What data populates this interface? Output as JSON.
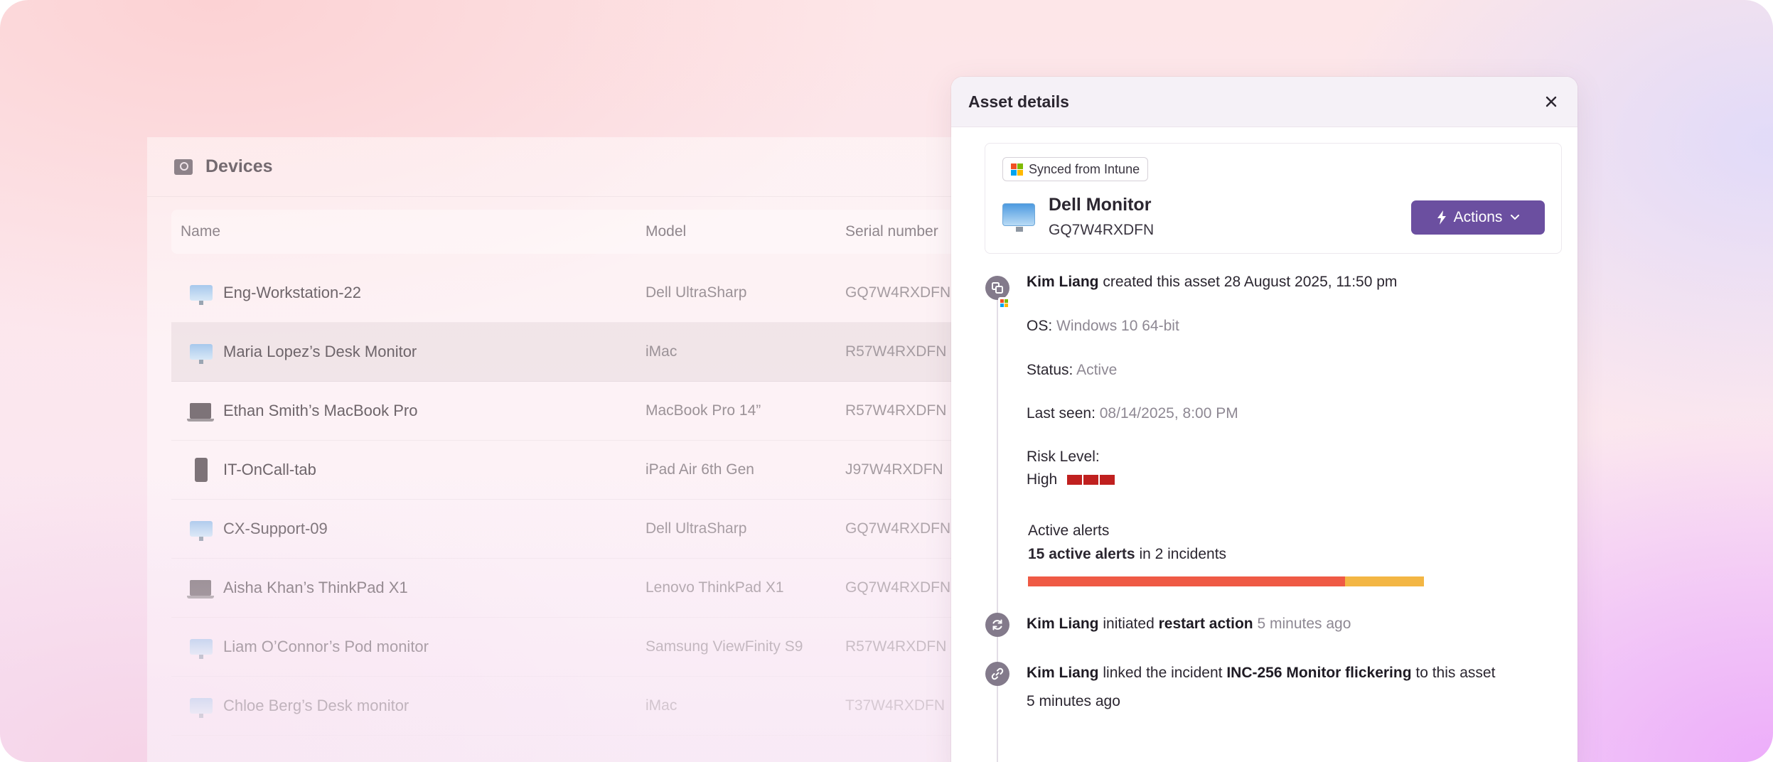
{
  "devices": {
    "title": "Devices",
    "columns": {
      "name": "Name",
      "model": "Model",
      "serial": "Serial number"
    },
    "rows": [
      {
        "name": "Eng-Workstation-22",
        "model": "Dell UltraSharp",
        "serial": "GQ7W4RXDFN",
        "icon": "monitor-icon"
      },
      {
        "name": "Maria Lopez’s Desk Monitor",
        "model": "iMac",
        "serial": "R57W4RXDFN",
        "icon": "monitor-icon",
        "selected": true
      },
      {
        "name": "Ethan Smith’s MacBook Pro",
        "model": "MacBook Pro 14”",
        "serial": "R57W4RXDFN",
        "icon": "laptop-icon"
      },
      {
        "name": "IT-OnCall-tab",
        "model": "iPad Air 6th Gen",
        "serial": "J97W4RXDFN",
        "icon": "tablet-icon"
      },
      {
        "name": "CX-Support-09",
        "model": "Dell UltraSharp",
        "serial": "GQ7W4RXDFN",
        "icon": "monitor-icon"
      },
      {
        "name": "Aisha Khan’s ThinkPad X1",
        "model": "Lenovo ThinkPad X1",
        "serial": "GQ7W4RXDFN",
        "icon": "laptop-icon"
      },
      {
        "name": "Liam O’Connor’s Pod monitor",
        "model": "Samsung ViewFinity S9",
        "serial": "R57W4RXDFN",
        "icon": "monitor-icon"
      },
      {
        "name": "Chloe Berg’s Desk monitor",
        "model": "iMac",
        "serial": "T37W4RXDFN",
        "icon": "monitor-icon"
      }
    ]
  },
  "drawer": {
    "title": "Asset details",
    "close_icon": "close-icon",
    "sync_badge": "Synced from Intune",
    "asset_name": "Dell Monitor",
    "asset_serial": "GQ7W4RXDFN",
    "actions_label": "Actions",
    "timeline": {
      "created": {
        "user": "Kim Liang",
        "text": "created this asset 28 August 2025, 11:50 pm"
      },
      "os": {
        "label": "OS:",
        "value": "Windows 10 64-bit"
      },
      "status": {
        "label": "Status:",
        "value": "Active"
      },
      "last_seen": {
        "label": "Last seen:",
        "value": "08/14/2025, 8:00 PM"
      },
      "risk": {
        "label": "Risk Level:",
        "value": "High",
        "level": 3,
        "color": "#c0201f"
      },
      "alerts": {
        "title": "Active alerts",
        "count_text": "15 active alerts",
        "suffix": "in 2 incidents",
        "red_fraction": 0.8,
        "amber_fraction": 0.2,
        "red_color": "#ef5a45",
        "amber_color": "#f3b644"
      },
      "restart": {
        "user": "Kim Liang",
        "verb": "initiated",
        "action": "restart action",
        "time": "5 minutes ago"
      },
      "linked": {
        "user": "Kim Liang",
        "verb": "linked the incident",
        "incident": "INC-256 Monitor flickering",
        "suffix": "to this asset",
        "time": "5 minutes ago"
      }
    }
  },
  "colors": {
    "accent": "#6b4fa0",
    "risk_high": "#c0201f"
  }
}
